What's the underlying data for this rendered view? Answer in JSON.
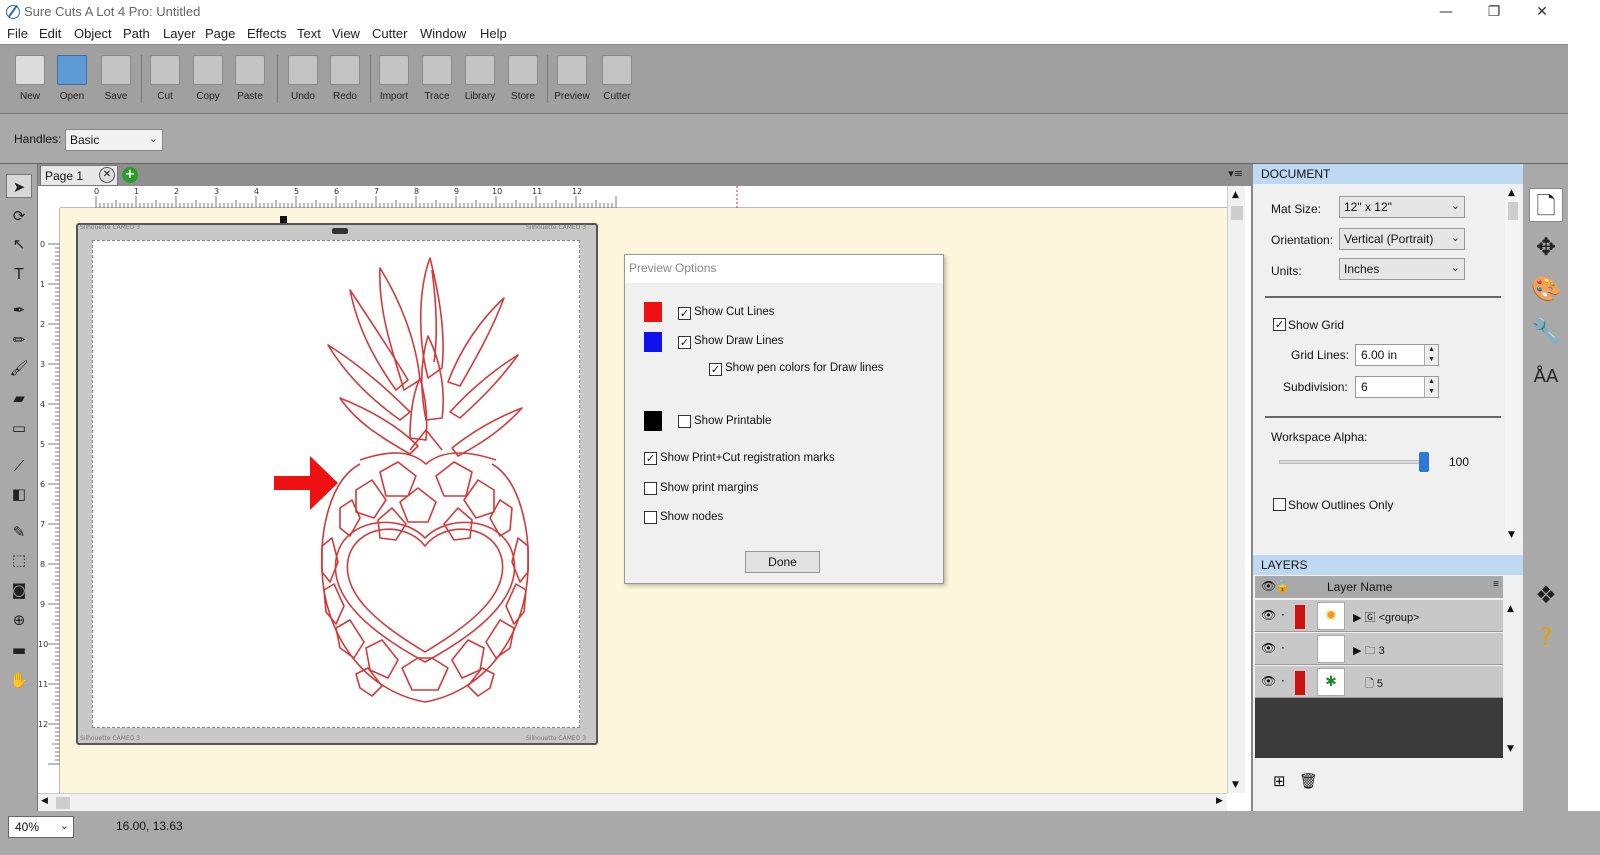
{
  "window": {
    "title": "Sure Cuts A Lot 4 Pro: Untitled",
    "min": "—",
    "max": "❐",
    "close": "✕"
  },
  "menu": [
    "File",
    "Edit",
    "Object",
    "Path",
    "Layer",
    "Page",
    "Effects",
    "Text",
    "View",
    "Cutter",
    "Window",
    "Help"
  ],
  "toolbar": [
    {
      "label": "New",
      "icon": "new-file-icon"
    },
    {
      "label": "Open",
      "icon": "open-folder-icon"
    },
    {
      "label": "Save",
      "icon": "save-disk-icon"
    },
    {
      "label": "Cut",
      "icon": "scissors-icon"
    },
    {
      "label": "Copy",
      "icon": "copy-icon"
    },
    {
      "label": "Paste",
      "icon": "paste-icon"
    },
    {
      "label": "Undo",
      "icon": "undo-icon"
    },
    {
      "label": "Redo",
      "icon": "redo-icon"
    },
    {
      "label": "Import",
      "icon": "import-icon"
    },
    {
      "label": "Trace",
      "icon": "trace-icon"
    },
    {
      "label": "Library",
      "icon": "library-icon"
    },
    {
      "label": "Store",
      "icon": "store-icon"
    },
    {
      "label": "Preview",
      "icon": "preview-icon"
    },
    {
      "label": "Cutter",
      "icon": "cutter-icon"
    }
  ],
  "options": {
    "handles_label": "Handles:",
    "handles_value": "Basic"
  },
  "page_tab": {
    "label": "Page 1"
  },
  "ruler": {
    "top": [
      "0",
      "1",
      "2",
      "3",
      "4",
      "5",
      "6",
      "7",
      "8",
      "9",
      "10",
      "11",
      "12"
    ],
    "left": [
      "0",
      "1",
      "2",
      "3",
      "4",
      "5",
      "6",
      "7",
      "8",
      "9",
      "10",
      "11",
      "12"
    ]
  },
  "mat": {
    "label": "Silhouette CAMEO 3"
  },
  "dialog": {
    "title": "Preview Options",
    "options": [
      {
        "label": "Show Cut Lines",
        "checked": true,
        "swatch": "#ee1111"
      },
      {
        "label": "Show Draw Lines",
        "checked": true,
        "swatch": "#1111ee"
      },
      {
        "label": "Show pen colors for Draw lines",
        "checked": true
      },
      {
        "label": "Show Printable",
        "checked": false,
        "swatch": "#000000"
      },
      {
        "label": "Show Print+Cut registration marks",
        "checked": true
      },
      {
        "label": "Show print margins",
        "checked": false
      },
      {
        "label": "Show nodes",
        "checked": false
      }
    ],
    "done": "Done"
  },
  "document": {
    "header": "DOCUMENT",
    "mat_size_label": "Mat Size:",
    "mat_size": "12\" x 12\"",
    "orientation_label": "Orientation:",
    "orientation": "Vertical (Portrait)",
    "units_label": "Units:",
    "units": "Inches",
    "show_grid": "Show Grid",
    "grid_lines_label": "Grid Lines:",
    "grid_lines": "6.00 in",
    "subdivision_label": "Subdivision:",
    "subdivision": "6",
    "alpha_label": "Workspace Alpha:",
    "alpha": "100",
    "show_outlines": "Show Outlines Only"
  },
  "layers": {
    "header": "LAYERS",
    "column": "Layer Name",
    "rows": [
      {
        "name": "<group>",
        "color": "#cc1111",
        "thumb": "pineapple-orange-icon"
      },
      {
        "name": "3",
        "color": "#ffffff",
        "thumb": "blank-icon"
      },
      {
        "name": "5",
        "color": "#cc1111",
        "thumb": "pineapple-green-icon"
      }
    ]
  },
  "status": {
    "zoom": "40%",
    "coords": "16.00, 13.63"
  },
  "colors": {
    "accent_red": "#ee1111",
    "panel_head": "#bfd9f2",
    "workspace": "#fdf6dc",
    "outline": "#d23a3a"
  }
}
